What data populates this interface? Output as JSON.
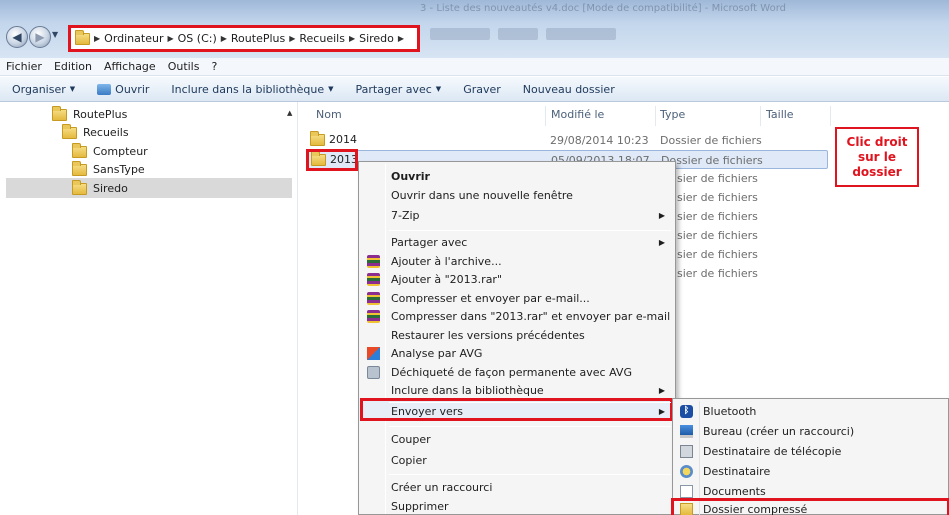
{
  "window": {
    "title": "3 - Liste des nouveautés v4.doc [Mode de compatibilité] - Microsoft Word"
  },
  "address": {
    "breadcrumbs": [
      "Ordinateur",
      "OS (C:)",
      "RoutePlus",
      "Recueils",
      "Siredo"
    ]
  },
  "menubar": [
    "Fichier",
    "Edition",
    "Affichage",
    "Outils",
    "?"
  ],
  "cmdbar": {
    "organiser": "Organiser",
    "ouvrir": "Ouvrir",
    "inclure": "Inclure dans la bibliothèque",
    "partager": "Partager avec",
    "graver": "Graver",
    "nouveau_dossier": "Nouveau dossier"
  },
  "tree": [
    "RoutePlus",
    "Recueils",
    "Compteur",
    "SansType",
    "Siredo"
  ],
  "columns": {
    "nom": "Nom",
    "modifie": "Modifié le",
    "type": "Type",
    "taille": "Taille"
  },
  "files": [
    {
      "name": "2014",
      "date": "29/08/2014 10:23",
      "type": "Dossier de fichiers"
    },
    {
      "name": "2013",
      "date": "05/09/2013 18:07",
      "type": "Dossier de fichiers"
    }
  ],
  "type_fragments": [
    "sier de fichiers",
    "sier de fichiers",
    "sier de fichiers",
    "sier de fichiers",
    "sier de fichiers",
    "sier de fichiers"
  ],
  "annotation": {
    "line1": "Clic droit",
    "line2": "sur le",
    "line3": "dossier"
  },
  "context_menu": {
    "ouvrir": "Ouvrir",
    "ouvrir_nouvelle": "Ouvrir dans une nouvelle fenêtre",
    "zip7": "7-Zip",
    "partager": "Partager avec",
    "ajouter_archive": "Ajouter à l'archive...",
    "ajouter_rar": "Ajouter à \"2013.rar\"",
    "compresser_email": "Compresser et envoyer par e-mail...",
    "compresser_rar_email": "Compresser dans \"2013.rar\" et envoyer par e-mail",
    "restaurer": "Restaurer les versions précédentes",
    "analyse_avg": "Analyse par AVG",
    "dechiquete_avg": "Déchiqueté de façon permanente avec AVG",
    "inclure": "Inclure dans la bibliothèque",
    "envoyer": "Envoyer vers",
    "couper": "Couper",
    "copier": "Copier",
    "creer_raccourci": "Créer un raccourci",
    "supprimer": "Supprimer"
  },
  "send_to": {
    "bluetooth": "Bluetooth",
    "bureau": "Bureau (créer un raccourci)",
    "telecopie": "Destinataire de télécopie",
    "destinataire": "Destinataire",
    "documents": "Documents",
    "compresse": "Dossier compressé"
  },
  "colors": {
    "highlight": "#e0141e",
    "selection": "#dfe9f7"
  }
}
